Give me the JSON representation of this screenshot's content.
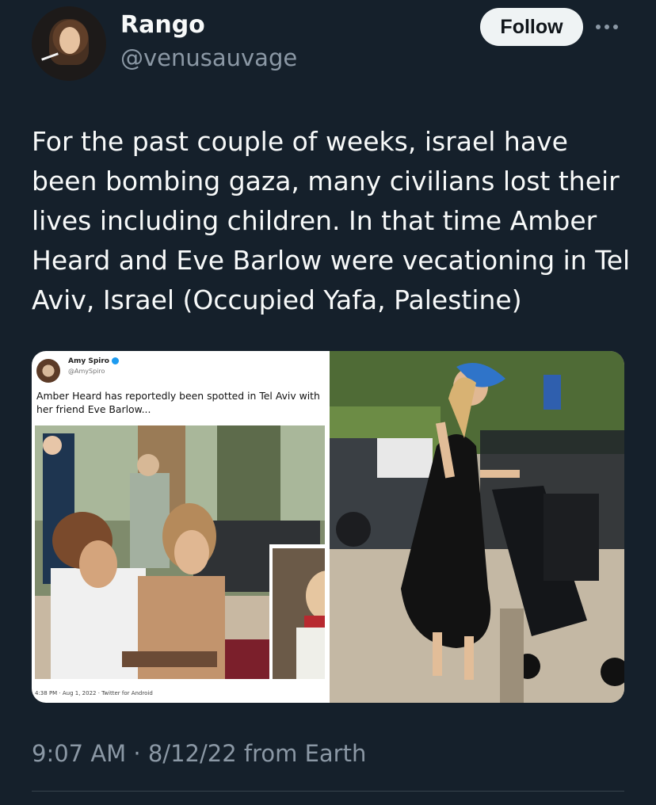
{
  "author": {
    "name": "Rango",
    "handle": "@venusauvage",
    "avatar_icon": "profile-photo"
  },
  "actions": {
    "follow_label": "Follow",
    "more_icon": "more-dots-icon"
  },
  "tweet": {
    "text": "For the past couple of weeks, israel have been bombing gaza, many civilians lost their lives including children. In that time Amber Heard and Eve Barlow were vecationing in Tel Aviv, Israel (Occupied Yafa, Palestine)",
    "timestamp": "9:07 AM · 8/12/22 from Earth"
  },
  "media": {
    "embedded_tweet": {
      "name": "Amy Spiro",
      "handle": "@AmySpiro",
      "text": "Amber Heard has reportedly been spotted in Tel Aviv with her friend Eve Barlow...",
      "footer": "4:38 PM · Aug 1, 2022 · Twitter for Android"
    }
  },
  "colors": {
    "background": "#15202b",
    "text_primary": "#f7f9f9",
    "text_secondary": "#8b98a5",
    "follow_bg": "#eff3f4",
    "divider": "#38444d",
    "verified": "#1d9bf0"
  }
}
